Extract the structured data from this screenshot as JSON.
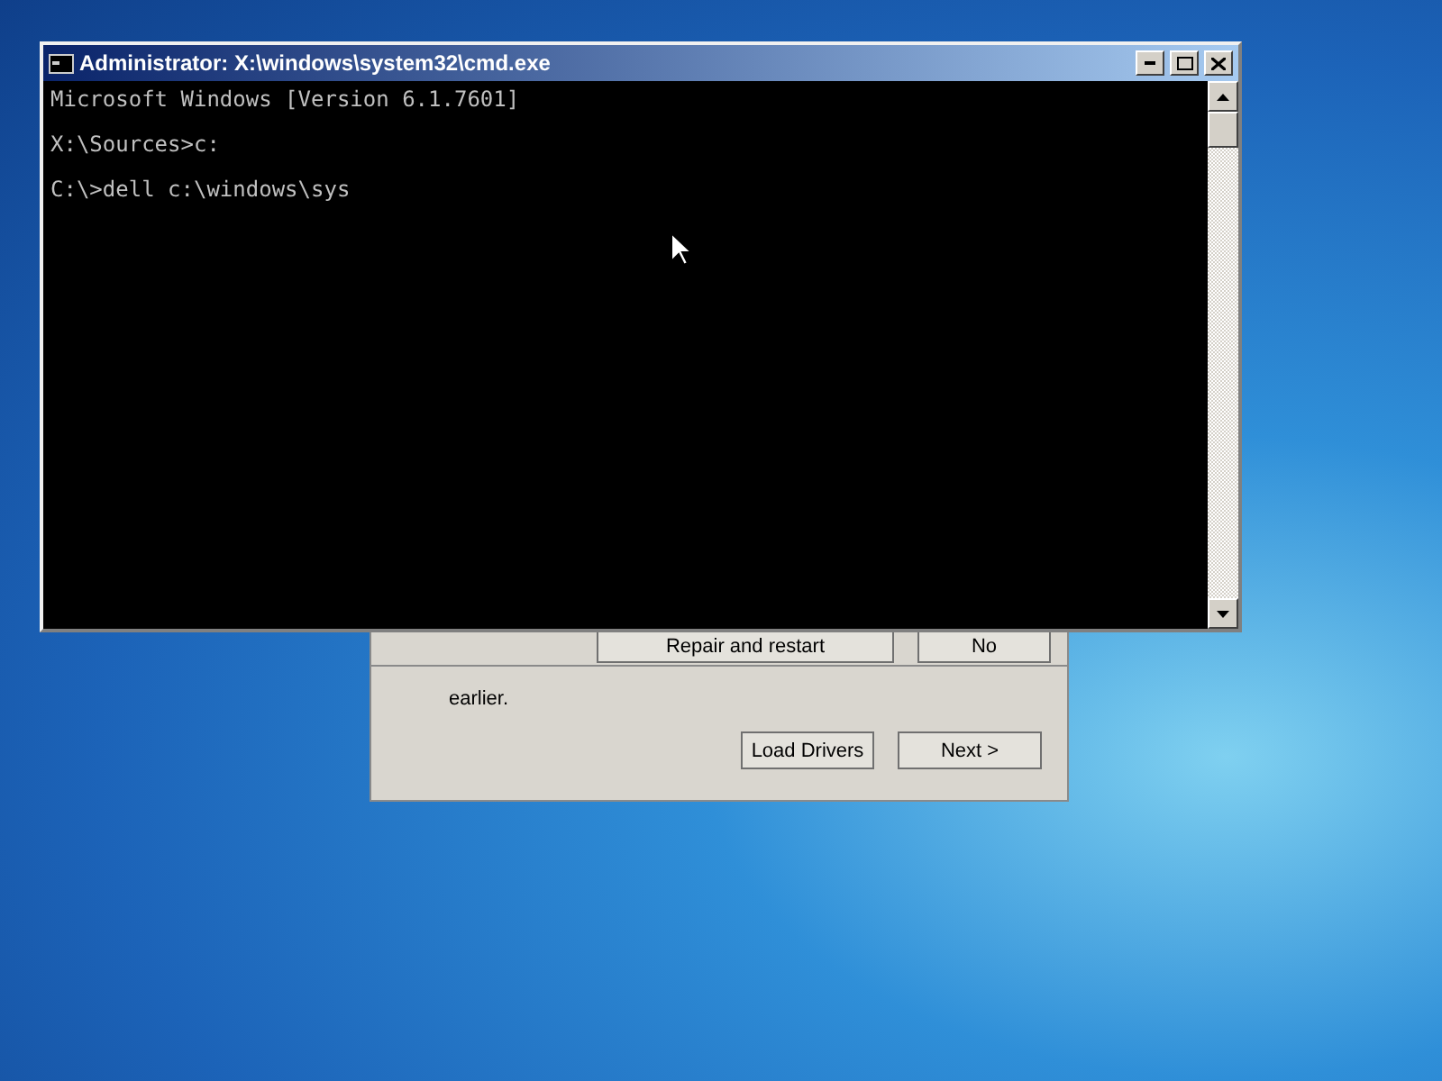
{
  "cmd_window": {
    "title": "Administrator: X:\\windows\\system32\\cmd.exe",
    "lines": [
      {
        "text": "Microsoft Windows [Version 6.1.7601]",
        "blank_before": false
      },
      {
        "text": "X:\\Sources>c:",
        "blank_before": true
      },
      {
        "text": "C:\\>dell c:\\windows\\sys",
        "blank_before": true
      }
    ]
  },
  "dialog": {
    "top_buttons": [
      "Repair and restart",
      "No"
    ],
    "text": "earlier.",
    "buttons": [
      "Load Drivers",
      "Next >"
    ]
  }
}
